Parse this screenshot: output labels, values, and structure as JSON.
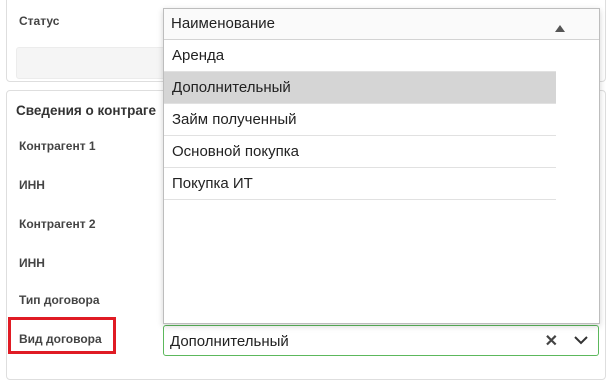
{
  "status": {
    "label": "Статус"
  },
  "section": {
    "title": "Сведения о контраге"
  },
  "labels": {
    "counterparty1": "Контрагент 1",
    "inn1": "ИНН",
    "counterparty2": "Контрагент 2",
    "inn2": "ИНН",
    "contract_type": "Тип договора",
    "contract_kind": "Вид договора"
  },
  "contract_kind_field": {
    "value": "Дополнительный",
    "clear_glyph": "✕"
  },
  "dropdown": {
    "header": "Наименование",
    "options": [
      {
        "label": "Аренда"
      },
      {
        "label": "Дополнительный",
        "selected": true
      },
      {
        "label": "Займ полученный"
      },
      {
        "label": "Основной покупка"
      },
      {
        "label": "Покупка ИТ"
      }
    ]
  },
  "colors": {
    "highlight": "#e01b24",
    "focus_border": "#5cb85c",
    "selected_row": "#d5d5d5"
  }
}
